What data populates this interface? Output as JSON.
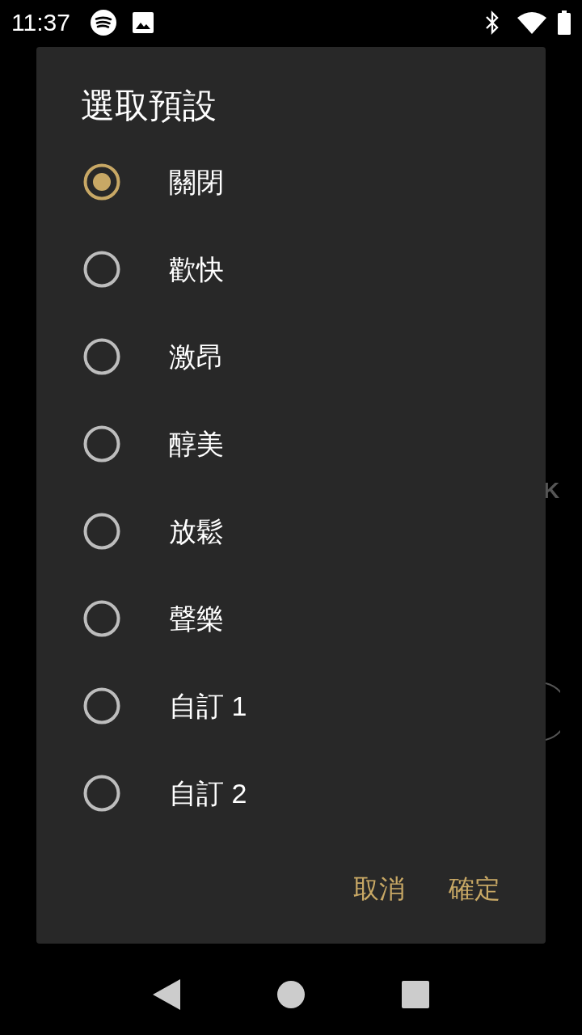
{
  "status_bar": {
    "time": "11:37"
  },
  "background": {
    "text": "K"
  },
  "dialog": {
    "title": "選取預設",
    "options": [
      {
        "label": "關閉",
        "selected": true
      },
      {
        "label": "歡快",
        "selected": false
      },
      {
        "label": "激昂",
        "selected": false
      },
      {
        "label": "醇美",
        "selected": false
      },
      {
        "label": "放鬆",
        "selected": false
      },
      {
        "label": "聲樂",
        "selected": false
      },
      {
        "label": "自訂 1",
        "selected": false
      },
      {
        "label": "自訂 2",
        "selected": false
      }
    ],
    "buttons": [
      "取消",
      "確定"
    ]
  }
}
